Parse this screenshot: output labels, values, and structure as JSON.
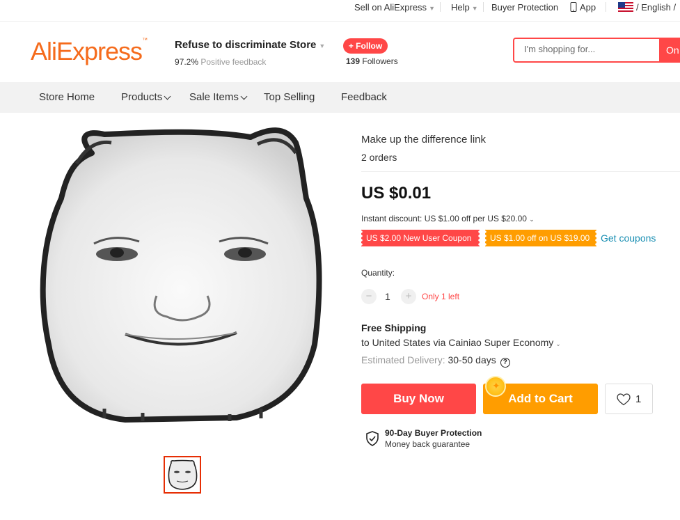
{
  "topbar": {
    "sell": "Sell on AliExpress",
    "help": "Help",
    "buyer_protection": "Buyer Protection",
    "app": "App",
    "language": "/ English /"
  },
  "header": {
    "logo": "AliExpress",
    "logo_tm": "™",
    "store_name": "Refuse to discriminate Store",
    "feedback_value": "97.2%",
    "feedback_label": "Positive feedback",
    "follow_label": "+ Follow",
    "followers_count": "139",
    "followers_label": "Followers",
    "search_placeholder": "I'm shopping for...",
    "search_button": "On"
  },
  "nav": {
    "items": [
      {
        "label": "Store Home",
        "dropdown": false
      },
      {
        "label": "Products",
        "dropdown": true
      },
      {
        "label": "Sale Items",
        "dropdown": true
      },
      {
        "label": "Top Selling",
        "dropdown": false
      },
      {
        "label": "Feedback",
        "dropdown": false
      }
    ]
  },
  "product": {
    "title": "Make up the difference link",
    "orders": "2 orders",
    "price": "US $0.01",
    "instant_discount": "Instant discount: US $1.00 off per US $20.00",
    "coupons": [
      {
        "label": "US $2.00 New User Coupon",
        "color": "#ff4747"
      },
      {
        "label": "US $1.00 off on US $19.00",
        "color": "#ff9d00"
      }
    ],
    "get_coupons": "Get coupons",
    "quantity_label": "Quantity:",
    "quantity": "1",
    "only_left": "Only 1 left",
    "shipping_title": "Free Shipping",
    "shipping_dest": "to United States via Cainiao Super Economy",
    "delivery_label": "Estimated Delivery:",
    "delivery_value": "30-50 days",
    "buy_now": "Buy Now",
    "add_to_cart": "Add to Cart",
    "wish_count": "1",
    "protection_title": "90-Day Buyer Protection",
    "protection_sub": "Money back guarantee"
  },
  "colors": {
    "accent_red": "#ff4747",
    "accent_orange": "#ff9d00",
    "link": "#1a8fb3",
    "logo_orange": "#f56b1c"
  }
}
